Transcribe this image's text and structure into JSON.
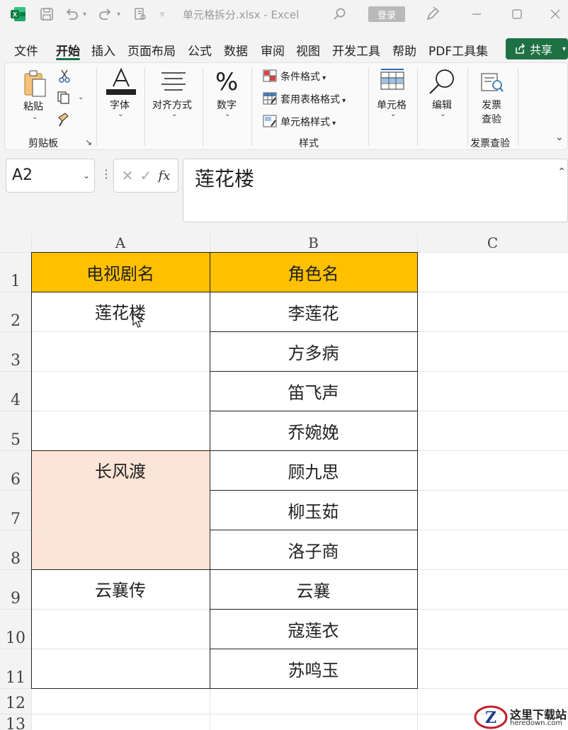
{
  "titlebar": {
    "filename": "单元格拆分.xlsx",
    "separator": "-",
    "app": "Excel",
    "login": "登录"
  },
  "menu": [
    "文件",
    "开始",
    "插入",
    "页面布局",
    "公式",
    "数据",
    "审阅",
    "视图",
    "开发工具",
    "帮助",
    "PDF工具集"
  ],
  "menu_active": "开始",
  "share_label": "共享",
  "ribbon": {
    "paste": "粘贴",
    "clipboard_group": "剪贴板",
    "font": "字体",
    "alignment": "对齐方式",
    "number": "数字",
    "conditional_format": "条件格式",
    "table_format": "套用表格格式",
    "cell_style": "单元格样式",
    "styles_group": "样式",
    "cells": "单元格",
    "editing": "编辑",
    "invoice_check_1": "发票",
    "invoice_check_2": "查验",
    "invoice_group": "发票查验"
  },
  "formula_bar": {
    "name_box": "A2",
    "fx": "fx",
    "content": "莲花楼"
  },
  "columns": [
    "A",
    "B",
    "C"
  ],
  "rows": [
    "1",
    "2",
    "3",
    "4",
    "5",
    "6",
    "7",
    "8",
    "9",
    "10",
    "11",
    "12",
    "13"
  ],
  "table": {
    "header": [
      "电视剧名",
      "角色名"
    ],
    "shows": [
      "莲花楼",
      "长风渡",
      "云襄传"
    ],
    "roles": [
      "李莲花",
      "方多病",
      "笛飞声",
      "乔婉娩",
      "顾九思",
      "柳玉茹",
      "洛子商",
      "云襄",
      "寇莲衣",
      "苏鸣玉"
    ]
  },
  "colors": {
    "header_fill": "#ffc000",
    "selected_fill": "#fce4d6",
    "excel_green": "#1e7145"
  },
  "watermark": {
    "title": "这里下载站",
    "url": "heredown.com"
  }
}
